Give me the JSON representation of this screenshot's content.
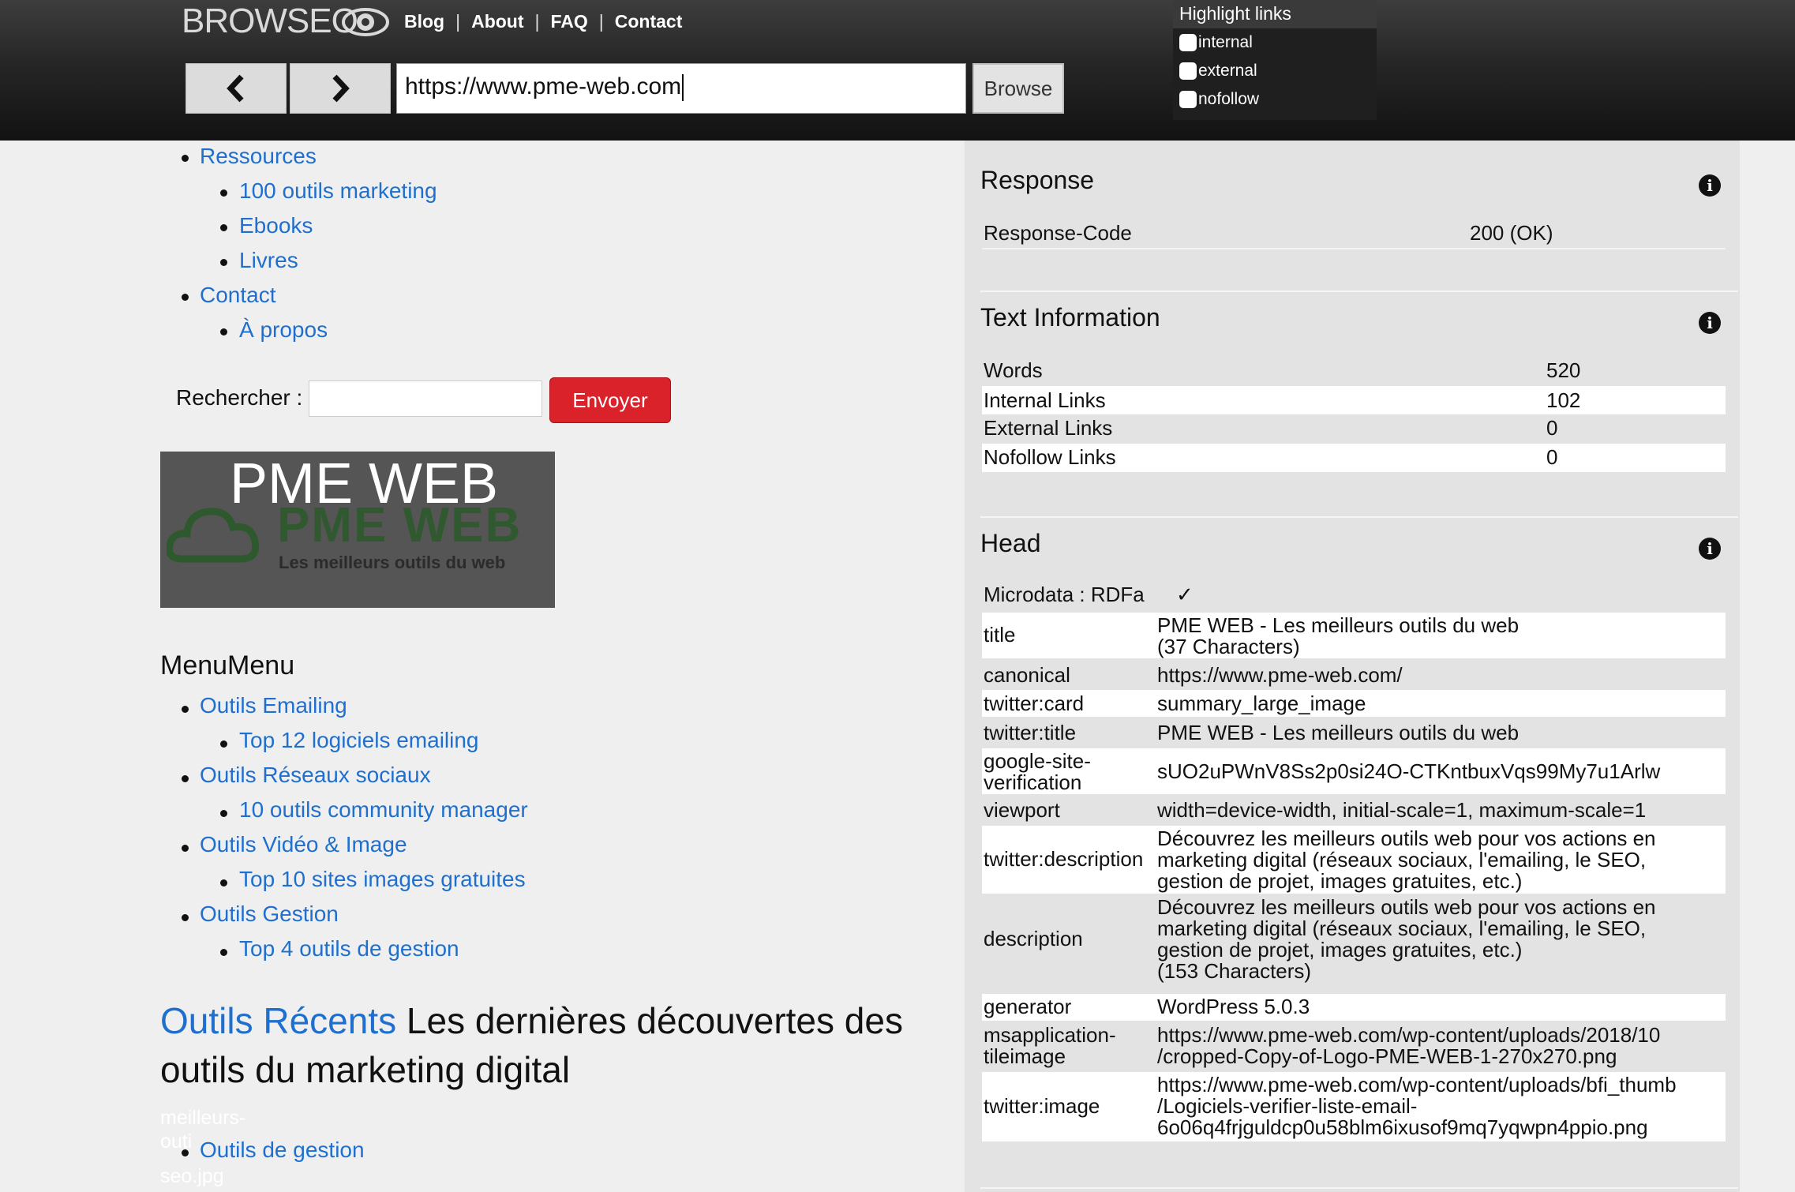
{
  "header": {
    "logo_text": "BROWSEO",
    "nav": [
      "Blog",
      "About",
      "FAQ",
      "Contact"
    ],
    "url": "https://www.pme-web.com",
    "browse_label": "Browse",
    "highlight": {
      "title": "Highlight links",
      "options": [
        "internal",
        "external",
        "nofollow"
      ]
    }
  },
  "page": {
    "top_menu": [
      {
        "label": "Ressources",
        "level": 1
      },
      {
        "label": "100 outils marketing",
        "level": 2
      },
      {
        "label": "Ebooks",
        "level": 2
      },
      {
        "label": "Livres",
        "level": 2
      },
      {
        "label": "Contact",
        "level": 1
      },
      {
        "label": "À propos",
        "level": 2
      }
    ],
    "search_label": "Rechercher :",
    "search_button": "Envoyer",
    "banner_title": "PME WEB",
    "banner_logo": "PME WEB",
    "banner_tagline": "Les meilleurs outils du web",
    "menu_title": "MenuMenu",
    "menu": [
      {
        "label": "Outils Emailing",
        "level": 1
      },
      {
        "label": "Top 12 logiciels emailing",
        "level": 2
      },
      {
        "label": "Outils Réseaux sociaux",
        "level": 1
      },
      {
        "label": "10 outils community manager",
        "level": 2
      },
      {
        "label": "Outils Vidéo & Image",
        "level": 1
      },
      {
        "label": "Top 10 sites images gratuites",
        "level": 2
      },
      {
        "label": "Outils Gestion",
        "level": 1
      },
      {
        "label": "Top 4 outils de gestion",
        "level": 2
      }
    ],
    "recent_link": "Outils Récents",
    "recent_text": " Les dernières découvertes des outils du marketing digital",
    "ghost_lines": [
      "meilleurs-",
      "outi",
      "seo.jpg"
    ],
    "last_item": "Outils de gestion"
  },
  "panel": {
    "response": {
      "title": "Response",
      "rows": [
        {
          "key": "Response-Code",
          "value": "200 (OK)"
        }
      ]
    },
    "text_info": {
      "title": "Text Information",
      "rows": [
        {
          "key": "Words",
          "value": "520"
        },
        {
          "key": "Internal Links",
          "value": "102"
        },
        {
          "key": "External Links",
          "value": "0"
        },
        {
          "key": "Nofollow Links",
          "value": "0"
        }
      ]
    },
    "head": {
      "title": "Head",
      "microdata_key": "Microdata : RDFa",
      "microdata_value": "✓",
      "rows": [
        {
          "key": "title",
          "value": [
            "PME WEB - Les meilleurs outils du web",
            "(37 Characters)"
          ]
        },
        {
          "key": "canonical",
          "value": [
            "https://www.pme-web.com/"
          ]
        },
        {
          "key": "twitter:card",
          "value": [
            "summary_large_image"
          ]
        },
        {
          "key": "twitter:title",
          "value": [
            "PME WEB - Les meilleurs outils du web"
          ]
        },
        {
          "key": [
            "google-site-",
            "verification"
          ],
          "value": [
            "sUO2uPWnV8Ss2p0si24O-CTKntbuxVqs99My7u1Arlw"
          ]
        },
        {
          "key": "viewport",
          "value": [
            "width=device-width, initial-scale=1, maximum-scale=1"
          ]
        },
        {
          "key": "twitter:description",
          "value": [
            "Découvrez les meilleurs outils web pour vos actions en",
            "marketing digital (réseaux sociaux, l'emailing, le SEO,",
            "gestion de projet, images gratuites, etc.)"
          ]
        },
        {
          "key": "description",
          "value": [
            "Découvrez les meilleurs outils web pour vos actions en",
            "marketing digital (réseaux sociaux, l'emailing, le SEO,",
            "gestion de projet, images gratuites, etc.)",
            "(153 Characters)"
          ]
        },
        {
          "key": "generator",
          "value": [
            "WordPress 5.0.3"
          ]
        },
        {
          "key": [
            "msapplication-",
            "tileimage"
          ],
          "value": [
            "https://www.pme-web.com/wp-content/uploads/2018/10",
            "/cropped-Copy-of-Logo-PME-WEB-1-270x270.png"
          ]
        },
        {
          "key": "twitter:image",
          "value": [
            "https://www.pme-web.com/wp-content/uploads/bfi_thumb",
            "/Logiciels-verifier-liste-email-",
            "6o06q4frjguldcp0u58blm6ixusof9mq7yqwpn4ppio.png"
          ]
        }
      ]
    }
  },
  "colors": {
    "link": "#1f6fcf",
    "send_button": "#d9222a",
    "panel_bg": "#e3e3e3",
    "page_bg": "#efefef"
  }
}
